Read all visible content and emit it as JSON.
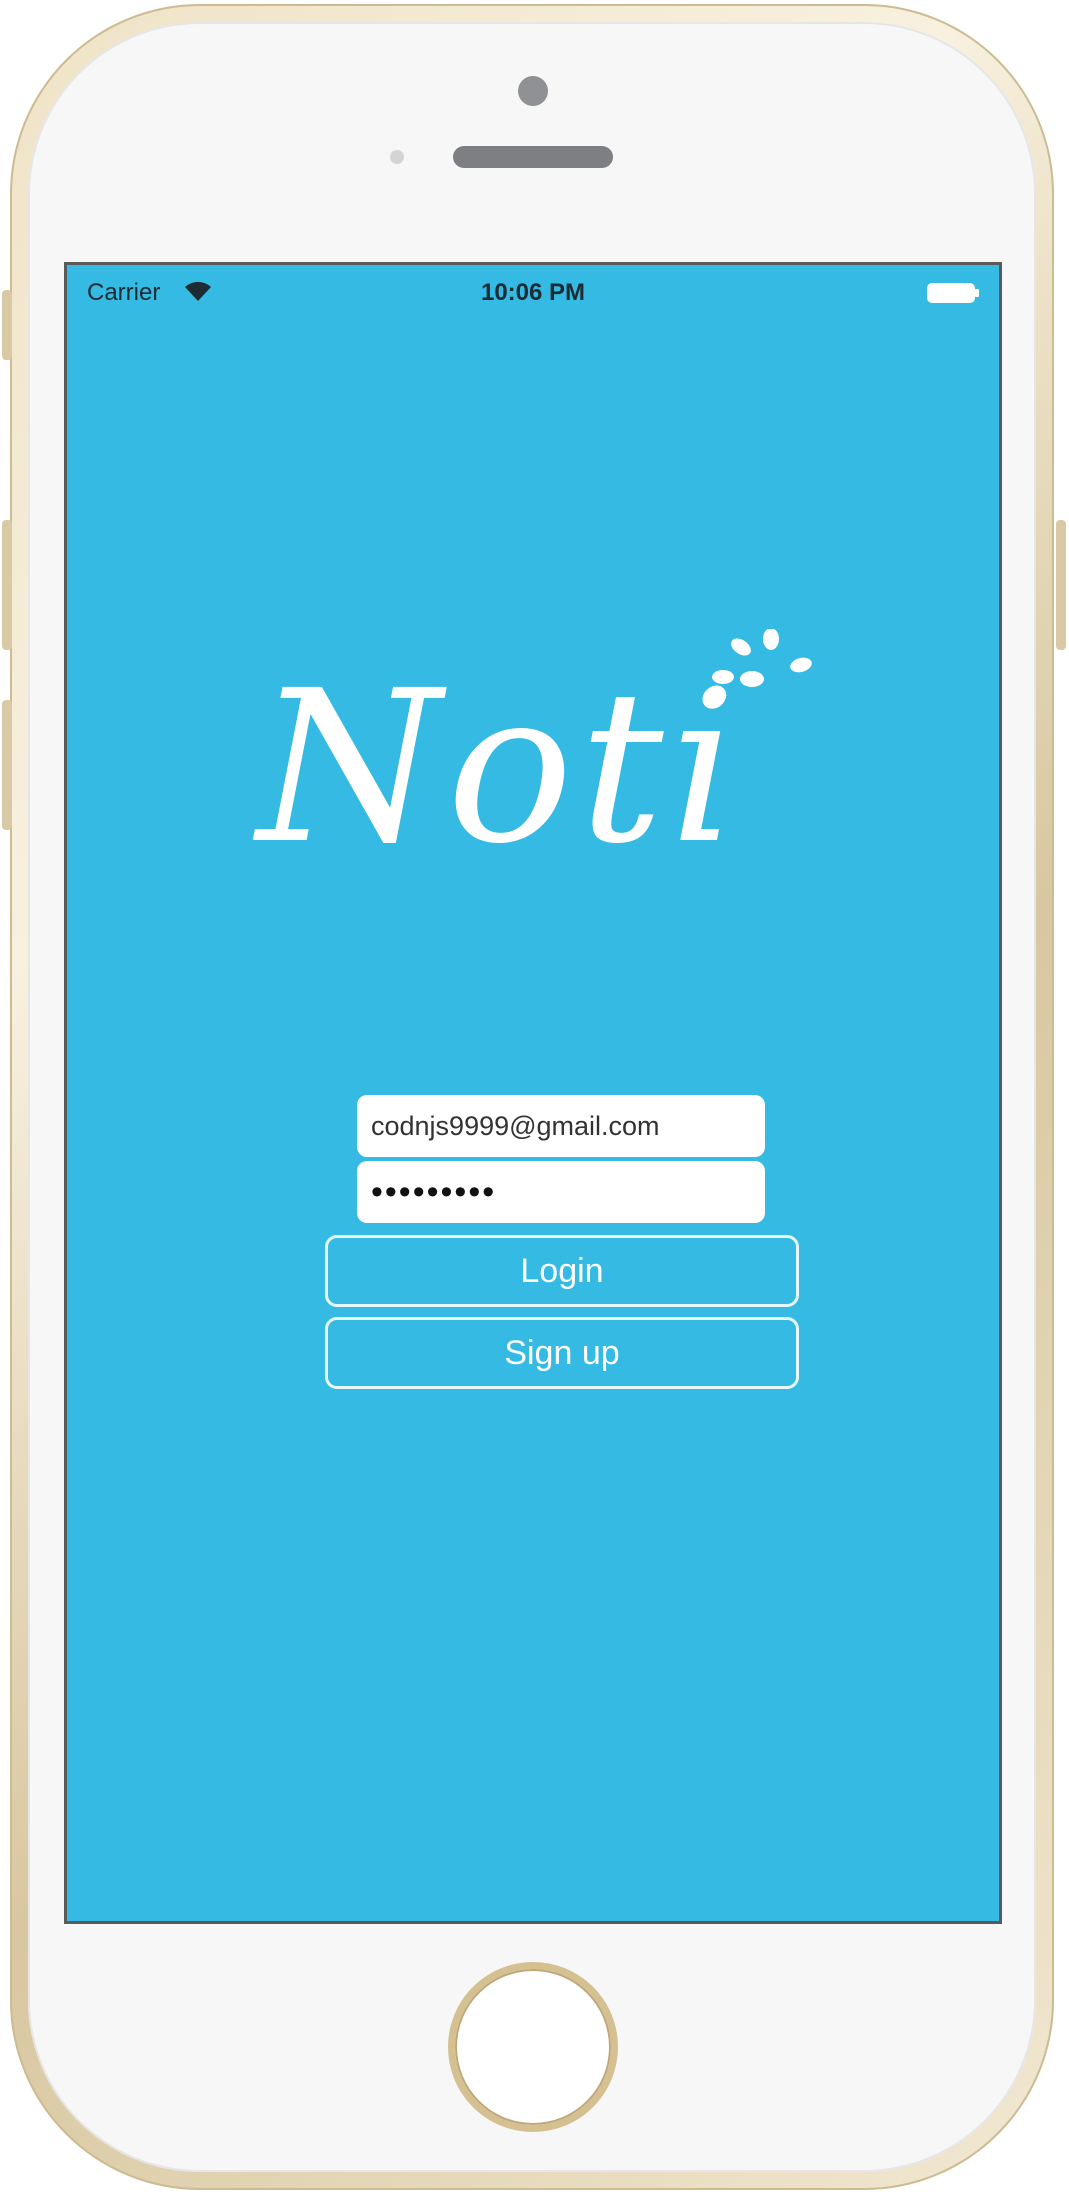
{
  "status_bar": {
    "carrier": "Carrier",
    "time": "10:06 PM",
    "wifi_icon": "wifi-icon",
    "battery_icon": "battery-icon"
  },
  "logo": {
    "text": "Noti"
  },
  "form": {
    "email_value": "codnjs9999@gmail.com",
    "password_value": "•••••••••",
    "login_label": "Login",
    "signup_label": "Sign up"
  },
  "colors": {
    "screen_background": "#34bae3",
    "text_on_accent": "#ffffff",
    "button_border": "#e8f7fc",
    "device_frame": "#efe3c6"
  }
}
